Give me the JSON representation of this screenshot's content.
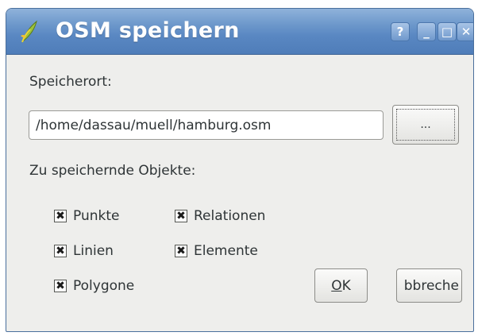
{
  "window": {
    "title": "OSM speichern",
    "icon": "qgis-leaf-icon",
    "controls": {
      "help_label": "?",
      "minimize_label": "_",
      "maximize_label": "□",
      "close_label": "✕"
    }
  },
  "location": {
    "label": "Speicherort:",
    "value": "/home/dassau/muell/hamburg.osm",
    "browse_label": "..."
  },
  "objects": {
    "label": "Zu speichernde Objekte:",
    "checkboxes": [
      {
        "label": "Punkte",
        "checked": true
      },
      {
        "label": "Linien",
        "checked": true
      },
      {
        "label": "Polygone",
        "checked": true
      },
      {
        "label": "Relationen",
        "checked": true
      },
      {
        "label": "Elemente",
        "checked": true
      }
    ]
  },
  "buttons": {
    "ok_mnemonic": "O",
    "ok_rest": "K",
    "cancel_label": "bbreche"
  },
  "colors": {
    "titlebar": "#5987c2",
    "window_bg": "#eeeeec",
    "text": "#2e3436"
  }
}
